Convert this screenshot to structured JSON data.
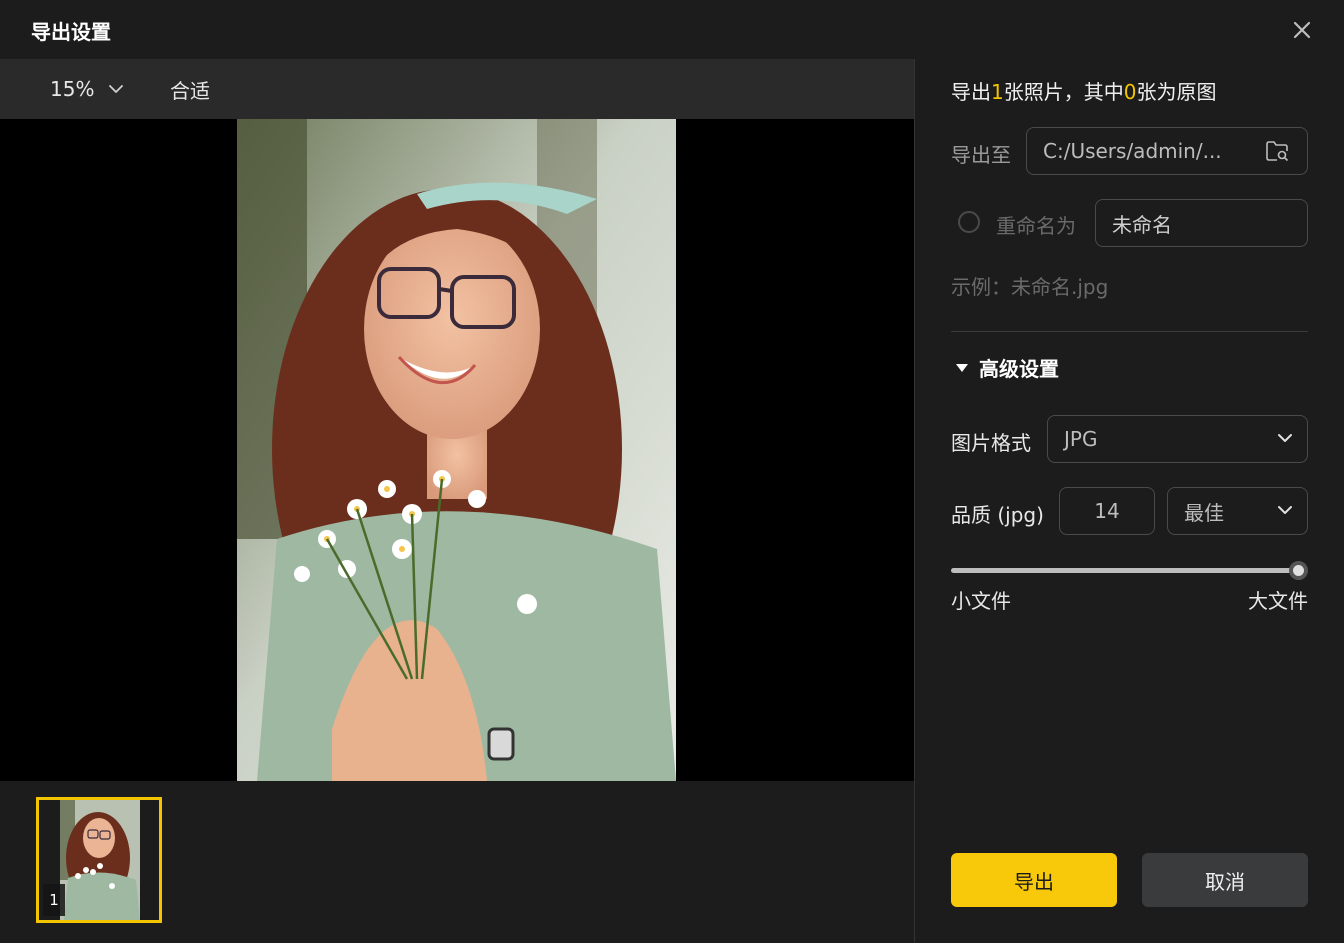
{
  "dialog": {
    "title": "导出设置"
  },
  "preview": {
    "zoom": "15%",
    "fit_label": "合适"
  },
  "thumbnails": [
    {
      "index": "1",
      "selected": true
    }
  ],
  "summary": {
    "prefix": "导出",
    "count": "1",
    "middle": "张照片，其中",
    "original_count": "0",
    "suffix": "张为原图"
  },
  "export_to": {
    "label": "导出至",
    "path": "C:/Users/admin/..."
  },
  "rename": {
    "label": "重命名为",
    "checked": false,
    "value": "未命名"
  },
  "example": {
    "text": "示例：未命名.jpg"
  },
  "advanced": {
    "label": "高级设置",
    "expanded": true
  },
  "format": {
    "label": "图片格式",
    "value": "JPG"
  },
  "quality": {
    "label": "品质 (jpg)",
    "value": "14",
    "preset": "最佳",
    "slider_level": 1.0,
    "min_label": "小文件",
    "max_label": "大文件"
  },
  "buttons": {
    "export": "导出",
    "cancel": "取消"
  },
  "colors": {
    "accent": "#f7c90a",
    "panel": "#1c1c1c",
    "toolbar": "#2a2a2a"
  }
}
